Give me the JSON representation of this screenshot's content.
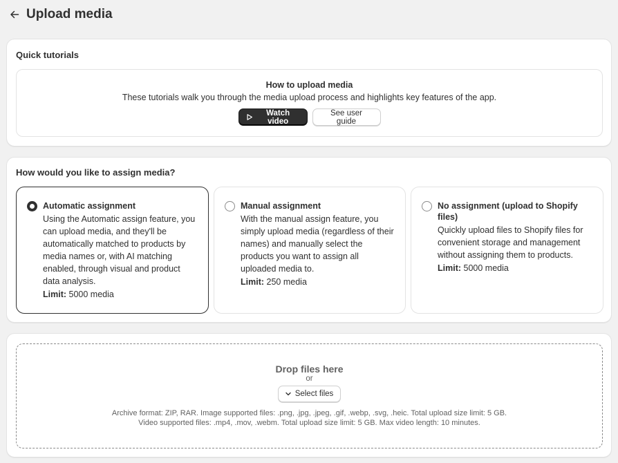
{
  "header": {
    "title": "Upload media"
  },
  "tutorials": {
    "title": "Quick tutorials",
    "heading": "How to upload media",
    "description": "These tutorials walk you through the media upload process and highlights key features of the app.",
    "watch_label": "Watch video",
    "guide_label": "See user guide"
  },
  "assign": {
    "title": "How would you like to assign media?",
    "selected": "automatic",
    "options": [
      {
        "title": "Automatic assignment",
        "description": "Using the Automatic assign feature, you can upload media, and they'll be automatically matched to products by media names or, with AI matching enabled, through visual and product data analysis.",
        "limit_label": "Limit:",
        "limit_value": "5000 media"
      },
      {
        "title": "Manual assignment",
        "description": "With the manual assign feature, you simply upload media (regardless of their names) and manually select the products you want to assign all uploaded media to.",
        "limit_label": "Limit:",
        "limit_value": "250 media"
      },
      {
        "title": "No assignment (upload to Shopify files)",
        "description": "Quickly upload files to Shopify files for convenient storage and management without assigning them to products.",
        "limit_label": "Limit:",
        "limit_value": "5000 media"
      }
    ]
  },
  "upload": {
    "drop_title": "Drop files here",
    "or_text": "or",
    "select_label": "Select files",
    "info_line1": "Archive format: ZIP, RAR. Image supported files: .png, .jpg, .jpeg, .gif, .webp, .svg, .heic. Total upload size limit: 5 GB.",
    "info_line2": "Video supported files: .mp4, .mov, .webm. Total upload size limit: 5 GB. Max video length: 10 minutes."
  },
  "icons": {
    "back": "arrow-left-icon",
    "play": "play-icon",
    "chevron": "chevron-down-icon"
  },
  "colors": {
    "background": "#f1f1f1",
    "primary_button": "#303030",
    "border": "#e3e3e3",
    "muted_text": "#616161"
  }
}
